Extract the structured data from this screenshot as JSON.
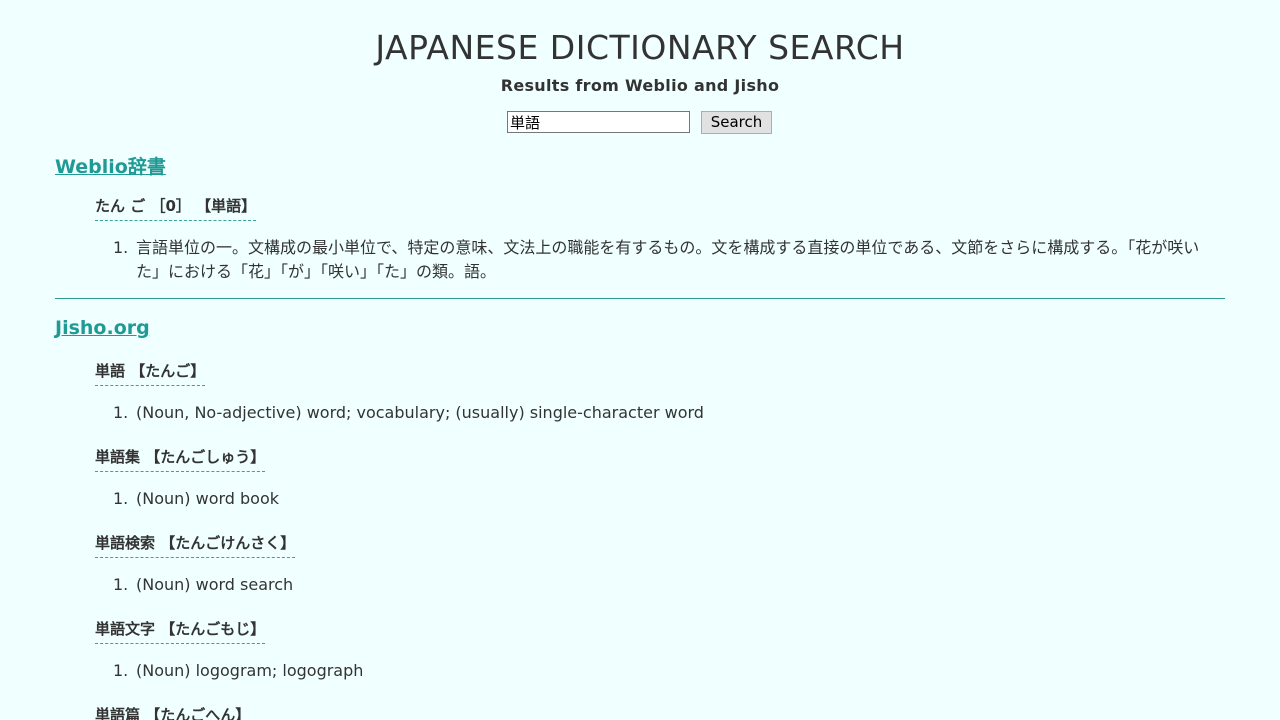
{
  "header": {
    "title": "JAPANESE DICTIONARY SEARCH",
    "subtitle": "Results from Weblio and Jisho"
  },
  "search": {
    "value": "単語",
    "button_label": "Search"
  },
  "weblio": {
    "source_label": "Weblio辞書",
    "entries": [
      {
        "head": "たん ご ［0］ 【単語】",
        "definitions": [
          {
            "number": "1.",
            "text": "言語単位の一。文構成の最小単位で、特定の意味、文法上の職能を有するもの。文を構成する直接の単位である、文節をさらに構成する。「花が咲いた」における「花」「が」「咲い」「た」の類。語。"
          }
        ]
      }
    ]
  },
  "jisho": {
    "source_label": "Jisho.org",
    "entries": [
      {
        "head": "単語 【たんご】",
        "definitions": [
          {
            "number": "1.",
            "text": "(Noun, No-adjective) word; vocabulary; (usually) single-character word"
          }
        ]
      },
      {
        "head": "単語集 【たんごしゅう】",
        "definitions": [
          {
            "number": "1.",
            "text": "(Noun) word book"
          }
        ]
      },
      {
        "head": "単語検索 【たんごけんさく】",
        "definitions": [
          {
            "number": "1.",
            "text": "(Noun) word search"
          }
        ]
      },
      {
        "head": "単語文字 【たんごもじ】",
        "definitions": [
          {
            "number": "1.",
            "text": "(Noun) logogram; logograph"
          }
        ]
      },
      {
        "head": "単語篇 【たんごへん】",
        "definitions": []
      }
    ]
  },
  "colors": {
    "background": "#f0ffff",
    "accent": "#1f9a94",
    "text": "#333333"
  }
}
